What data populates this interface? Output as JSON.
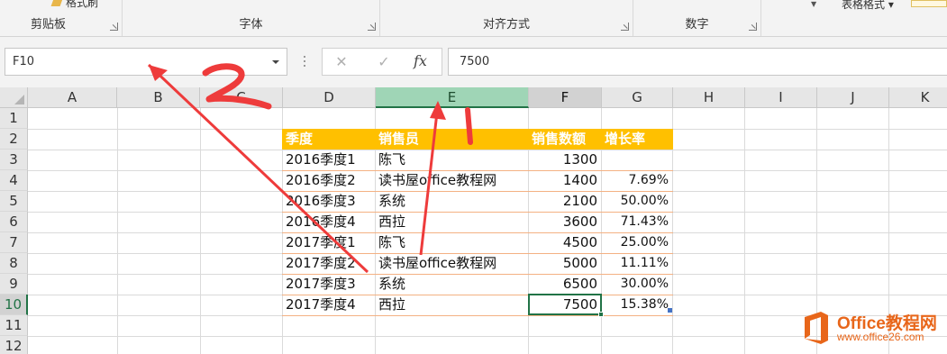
{
  "ribbon": {
    "groups": [
      {
        "label": "剪贴板"
      },
      {
        "label": "字体"
      },
      {
        "label": "对齐方式"
      },
      {
        "label": "数字"
      }
    ],
    "format_painter_label": "格式刷",
    "table_format_label": "表格格式"
  },
  "formula_bar": {
    "name_box": "F10",
    "cancel_icon": "✕",
    "enter_icon": "✓",
    "fx_label": "fx",
    "formula_value": "7500"
  },
  "columns": [
    "A",
    "B",
    "C",
    "D",
    "E",
    "F",
    "G",
    "H",
    "I",
    "J",
    "K"
  ],
  "rows": [
    "1",
    "2",
    "3",
    "4",
    "5",
    "6",
    "7",
    "8",
    "9",
    "10",
    "11",
    "12"
  ],
  "active_cell": "F10",
  "selected_column": "E",
  "table": {
    "headers": [
      "季度",
      "销售员",
      "销售数额",
      "增长率"
    ],
    "rows": [
      [
        "2016季度1",
        "陈飞",
        "1300",
        ""
      ],
      [
        "2016季度2",
        "读书屋office教程网",
        "1400",
        "7.69%"
      ],
      [
        "2016季度3",
        "系统",
        "2100",
        "50.00%"
      ],
      [
        "2016季度4",
        "西拉",
        "3600",
        "71.43%"
      ],
      [
        "2017季度1",
        "陈飞",
        "4500",
        "25.00%"
      ],
      [
        "2017季度2",
        "读书屋office教程网",
        "5000",
        "11.11%"
      ],
      [
        "2017季度3",
        "系统",
        "6500",
        "30.00%"
      ],
      [
        "2017季度4",
        "西拉",
        "7500",
        "15.38%"
      ]
    ],
    "header_color": "#ffc000",
    "border_color": "#f4b183"
  },
  "annotations": {
    "label_1": "1",
    "label_2": "2",
    "color": "#ee3b3b"
  },
  "watermark": {
    "title": "Office教程网",
    "url": "www.office26.com",
    "color": "#e8661a"
  },
  "colors": {
    "accent": "#217346",
    "selected_header": "#9fd5b6"
  }
}
